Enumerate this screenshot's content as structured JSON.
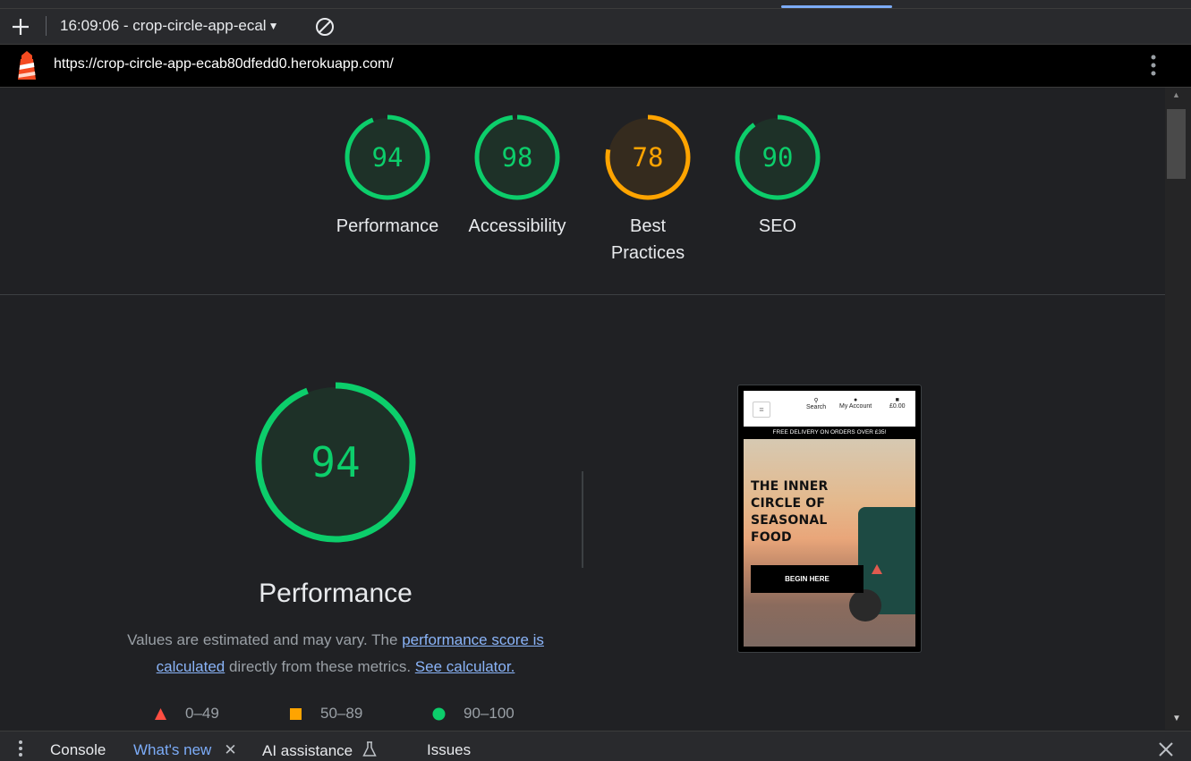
{
  "toolbar": {
    "report_label": "16:09:06 - crop-circle-app-ecal"
  },
  "urlbar": {
    "url": "https://crop-circle-app-ecab80dfedd0.herokuapp.com/"
  },
  "gauges": [
    {
      "score": "94",
      "value": 94,
      "label": "Performance",
      "status": "pass"
    },
    {
      "score": "98",
      "value": 98,
      "label": "Accessibility",
      "status": "pass"
    },
    {
      "score": "78",
      "value": 78,
      "label": "Best Practices",
      "status": "average"
    },
    {
      "score": "90",
      "value": 90,
      "label": "SEO",
      "status": "pass"
    }
  ],
  "colors": {
    "pass": "#0cce6b",
    "pass_bg": "#1e3128",
    "average": "#ffa400",
    "average_bg": "#352b1e",
    "fail": "#ff4e42"
  },
  "performance": {
    "score": "94",
    "value": 94,
    "title": "Performance",
    "desc_prefix": "Values are estimated and may vary. The ",
    "link1": "performance score is calculated",
    "desc_mid": " directly from these metrics. ",
    "link2": "See calculator."
  },
  "legend": [
    {
      "range": "0–49",
      "shape": "triangle"
    },
    {
      "range": "50–89",
      "shape": "square"
    },
    {
      "range": "90–100",
      "shape": "circle"
    }
  ],
  "screenshot": {
    "search": "Search",
    "account": "My Account",
    "cart": "£0.00",
    "banner": "FREE DELIVERY ON ORDERS OVER £35!",
    "headline": "THE INNER CIRCLE OF SEASONAL FOOD",
    "cta": "BEGIN HERE"
  },
  "drawer": {
    "tabs": [
      "Console",
      "What's new",
      "AI assistance",
      "Issues"
    ],
    "active": "What's new"
  }
}
